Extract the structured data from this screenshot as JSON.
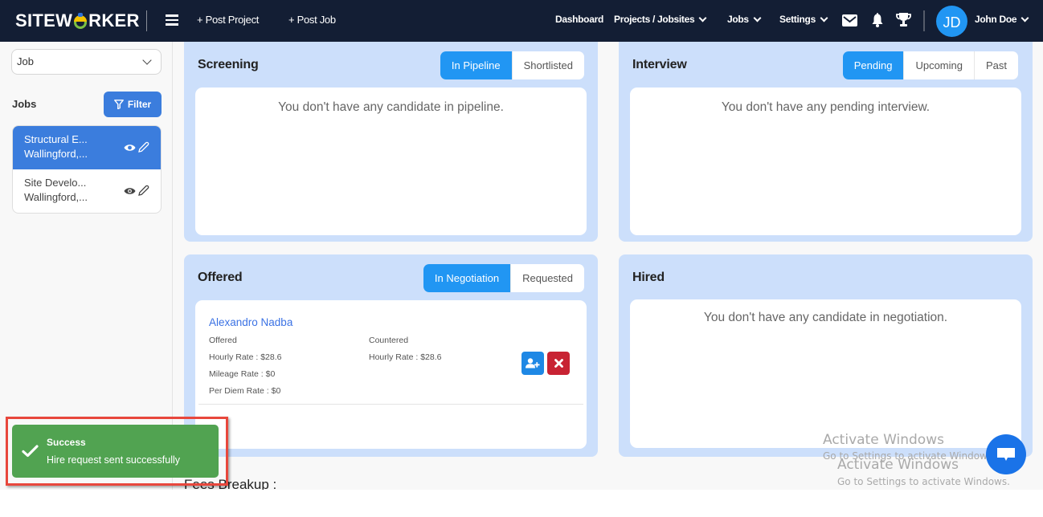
{
  "navbar": {
    "logo": {
      "left": "SITEW",
      "right": "RKER"
    },
    "post_project": "+ Post Project",
    "post_job": "+ Post Job",
    "dashboard": "Dashboard",
    "projects": "Projects / Jobsites",
    "jobs": "Jobs",
    "settings": "Settings",
    "icons": [
      "mail-icon",
      "bell-icon",
      "trophy-icon"
    ],
    "avatar_initials": "JD",
    "user_name": "John Doe"
  },
  "sidebar": {
    "select_value": "Job",
    "jobs_label": "Jobs",
    "filter_label": "Filter",
    "jobs": [
      {
        "title": "Structural E...",
        "location": "Wallingford,...",
        "active": true
      },
      {
        "title": "Site Develo...",
        "location": "Wallingford,...",
        "active": false
      }
    ]
  },
  "panels": {
    "screening": {
      "title": "Screening",
      "tabs": [
        "In Pipeline",
        "Shortlisted"
      ],
      "active_tab": "In Pipeline",
      "empty": "You don't have any candidate in pipeline."
    },
    "interview": {
      "title": "Interview",
      "tabs": [
        "Pending",
        "Upcoming",
        "Past"
      ],
      "active_tab": "Pending",
      "empty": "You don't have any pending interview."
    },
    "offered": {
      "title": "Offered",
      "tabs": [
        "In Negotiation",
        "Requested"
      ],
      "active_tab": "In Negotiation",
      "candidate": {
        "name": "Alexandro Nadba",
        "offered_label": "Offered",
        "offered": [
          "Hourly Rate : $28.6",
          "Mileage Rate : $0",
          "Per Diem Rate : $0"
        ],
        "countered_label": "Countered",
        "countered": [
          "Hourly Rate : $28.6"
        ]
      }
    },
    "hired": {
      "title": "Hired",
      "empty": "You don't have any candidate in negotiation."
    }
  },
  "fees_heading": "Fees Breakup :",
  "toast": {
    "title": "Success",
    "message": "Hire request sent successfully"
  },
  "watermark": {
    "title": "Activate Windows",
    "subtitle": "Go to Settings to activate Windows."
  },
  "colors": {
    "navbar": "#131e34",
    "primary": "#2196f3",
    "sidebar_active": "#3b7ddd",
    "panel_bg": "#ccdffb",
    "success": "#51a351",
    "danger": "#c82333",
    "highlight": "#e8473c"
  }
}
